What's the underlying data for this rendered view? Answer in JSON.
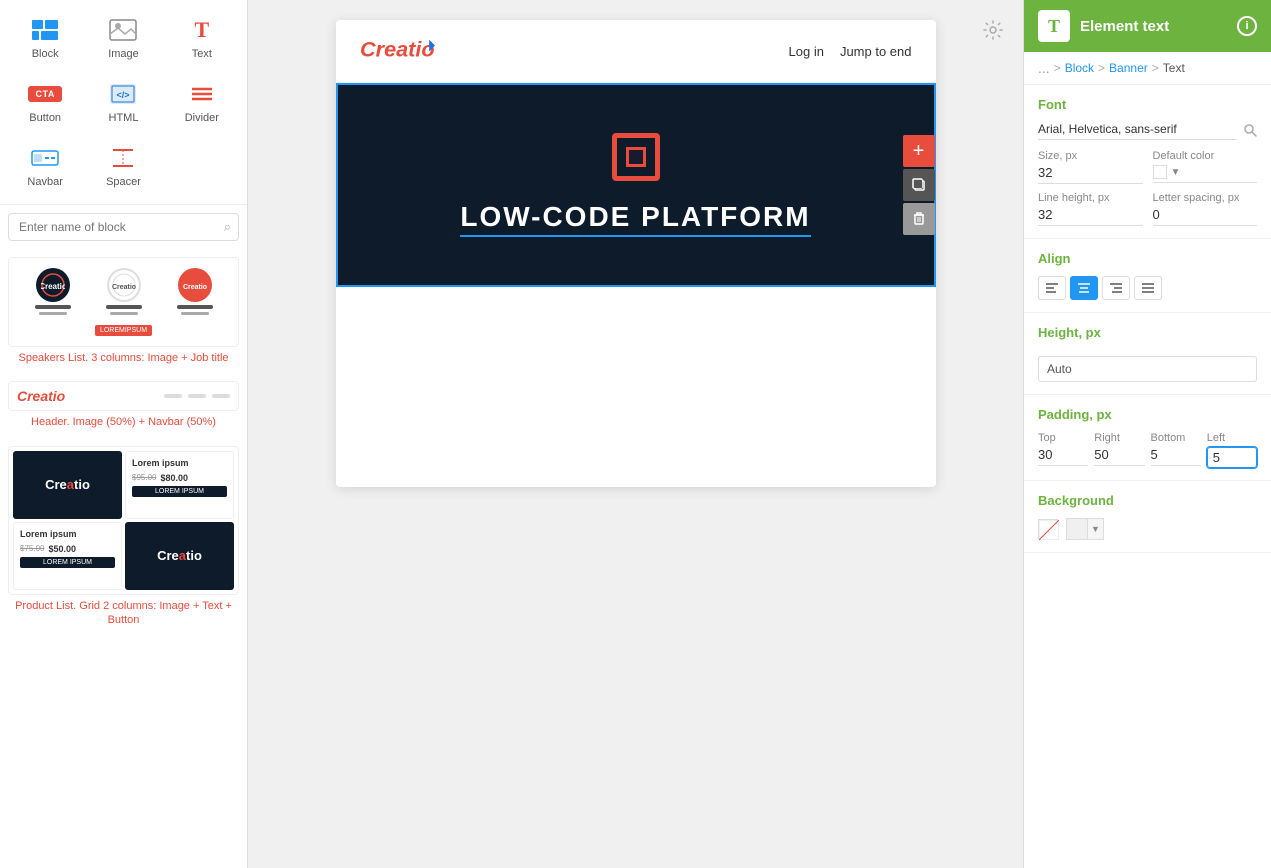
{
  "left_sidebar": {
    "blocks": [
      {
        "id": "block",
        "label": "Block",
        "icon": "grid"
      },
      {
        "id": "image",
        "label": "Image",
        "icon": "image"
      },
      {
        "id": "text",
        "label": "Text",
        "icon": "T"
      },
      {
        "id": "button",
        "label": "Button",
        "icon": "CTA"
      },
      {
        "id": "html",
        "label": "HTML",
        "icon": "html"
      },
      {
        "id": "divider",
        "label": "Divider",
        "icon": "divider"
      },
      {
        "id": "navbar",
        "label": "Navbar",
        "icon": "navbar"
      },
      {
        "id": "spacer",
        "label": "Spacer",
        "icon": "spacer"
      }
    ],
    "search_placeholder": "Enter name of block",
    "previews": [
      {
        "id": "speakers",
        "caption": "Speakers List. 3 columns: Image + Job title"
      },
      {
        "id": "header",
        "caption": "Header. Image (50%) + Navbar (50%)"
      },
      {
        "id": "product",
        "caption": "Product List. Grid 2 columns: Image + Text + Button"
      }
    ]
  },
  "canvas": {
    "logo_text": "Creatio",
    "nav_items": [
      "Log in",
      "Jump to end"
    ],
    "banner_text": "LOW-CODE PLATFORM",
    "section_empty": true
  },
  "breadcrumb": {
    "dots": "...",
    "block": "Block",
    "banner": "Banner",
    "text": "Text"
  },
  "right_panel": {
    "header": {
      "title": "Element text",
      "icon_label": "T"
    },
    "font": {
      "label": "Font",
      "value": "Arial, Helvetica, sans-serif",
      "search_icon": "🔍"
    },
    "size": {
      "label": "Size, px",
      "value": "32"
    },
    "default_color": {
      "label": "Default color"
    },
    "line_height": {
      "label": "Line height, px",
      "value": "32"
    },
    "letter_spacing": {
      "label": "Letter spacing, px",
      "value": "0"
    },
    "align": {
      "label": "Align",
      "options": [
        "left",
        "center",
        "right",
        "justify"
      ],
      "active": "center"
    },
    "height": {
      "label": "Height, px",
      "value": "Auto"
    },
    "padding": {
      "label": "Padding, px",
      "top_label": "Top",
      "right_label": "Right",
      "bottom_label": "Bottom",
      "left_label": "Left",
      "top": "30",
      "right": "50",
      "bottom": "5",
      "left": "5"
    },
    "background": {
      "label": "Background"
    }
  }
}
